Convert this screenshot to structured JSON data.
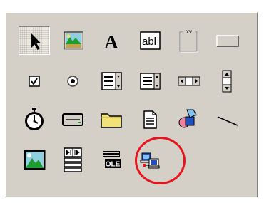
{
  "toolbox": {
    "rows": [
      [
        "Pointer",
        "Picture",
        "Label",
        "Text Box",
        "Frame",
        "Command Button"
      ],
      [
        "Check Box",
        "Option Button",
        "Combo Box",
        "List Box",
        "Horizontal Scroll Bar",
        "Vertical Scroll Bar"
      ],
      [
        "Timer",
        "Drive List Box",
        "Directory List Box",
        "File List Box",
        "Shape",
        "Line"
      ],
      [
        "Image",
        "Data",
        "OLE Container",
        "Custom Control"
      ]
    ],
    "selected_tool": "Pointer",
    "highlighted_tool": "Custom Control"
  },
  "glyphs": {
    "label_letter": "A",
    "textbox_text": "abl",
    "frame_caption": "xv",
    "ole_text": "OLE"
  },
  "colors": {
    "toolbox_face": "#d4d0c8",
    "highlight_ring": "#e8141c",
    "icon_black": "#000000",
    "picture_green": "#1e9c2e",
    "folder_yellow": "#f2e078",
    "shape_blue": "#2050c0",
    "shape_pink": "#f080a0"
  }
}
